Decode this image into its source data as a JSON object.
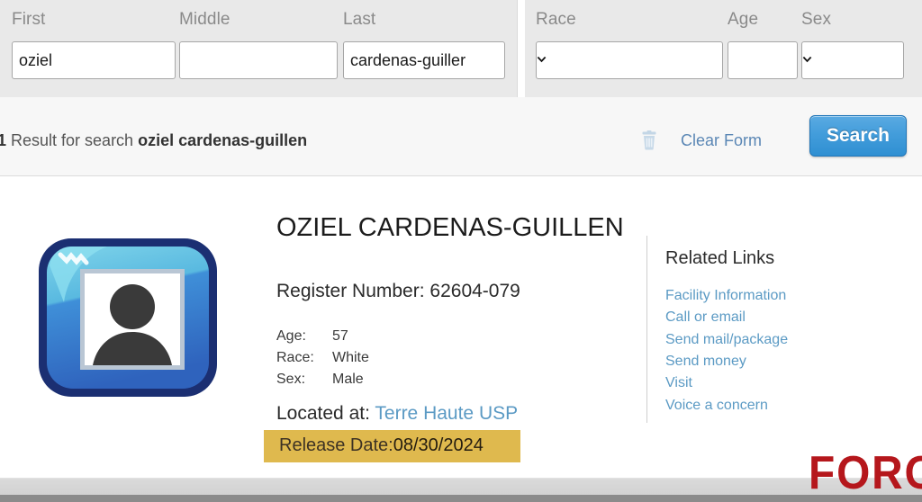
{
  "search_form": {
    "fields": [
      {
        "key": "first",
        "label": "First",
        "type": "text",
        "value": "oziel",
        "placeholder": ""
      },
      {
        "key": "middle",
        "label": "Middle",
        "type": "text",
        "value": "",
        "placeholder": ""
      },
      {
        "key": "last",
        "label": "Last",
        "type": "text",
        "value": "cardenas-guiller",
        "placeholder": ""
      },
      {
        "key": "race",
        "label": "Race",
        "type": "select",
        "value": "",
        "placeholder": ""
      },
      {
        "key": "age",
        "label": "Age",
        "type": "text",
        "value": "",
        "placeholder": ""
      },
      {
        "key": "sex",
        "label": "Sex",
        "type": "select",
        "value": "",
        "placeholder": ""
      }
    ]
  },
  "result_bar": {
    "count": "1",
    "count_suffix": " Result for search ",
    "query": "oziel cardenas-guillen",
    "clear_form_label": "Clear Form",
    "clear_form_icon": "trash-icon",
    "search_button_label": "Search",
    "search_button_color": "#3f9bd9"
  },
  "result": {
    "photo_icon": "person-photo-placeholder-icon",
    "name": "OZIEL CARDENAS-GUILLEN",
    "register_label": "Register Number:",
    "register_number": "62604-079",
    "attributes": [
      {
        "key": "Age:",
        "value": "57"
      },
      {
        "key": "Race:",
        "value": "White"
      },
      {
        "key": "Sex:",
        "value": "Male"
      }
    ],
    "located_label": "Located at:",
    "located_facility": "Terre Haute USP",
    "release_label": "Release Date:",
    "release_date": "08/30/2024",
    "release_highlight_color": "#dfb94e"
  },
  "related_links": {
    "title": "Related Links",
    "items": [
      "Facility Information",
      "Call or email",
      "Send mail/package",
      "Send money",
      "Visit",
      "Voice a concern"
    ],
    "link_color": "#5b9ac4"
  },
  "watermark": {
    "text": "FORO",
    "color": "#b5171c"
  }
}
